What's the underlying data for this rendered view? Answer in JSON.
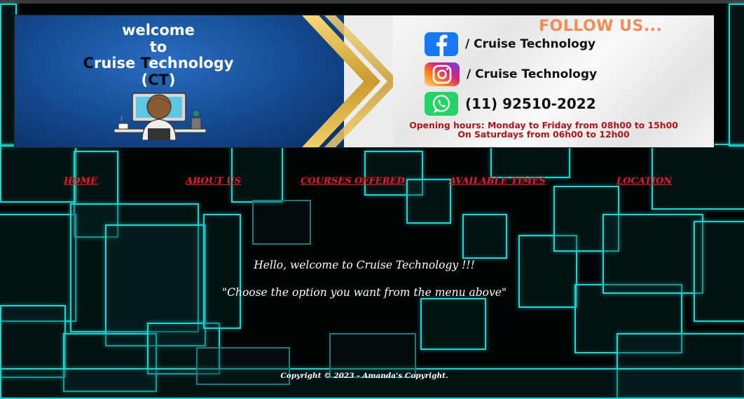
{
  "banner": {
    "welcome_line1": "welcome",
    "welcome_line2": "to",
    "welcome_c": "C",
    "welcome_ruise": "ruise ",
    "welcome_t": "T",
    "welcome_echnology": "echnology",
    "welcome_paren_open": "(",
    "welcome_ct": "CT",
    "welcome_paren_close": ")",
    "follow_us": "FOLLOW US...",
    "facebook": "/ Cruise Technology",
    "instagram": "/ Cruise Technology",
    "whatsapp": "(11) 92510-2022",
    "hours_line1": "Opening hours: Monday to Friday from 08h00 to 15h00",
    "hours_line2": "On Saturdays from 06h00 to 12h00",
    "colors": {
      "follow": "#f48c55",
      "hours": "#b0151a",
      "blue": "#175098"
    }
  },
  "nav": {
    "home": "HOME",
    "about": "ABOUT US",
    "courses": "COURSES OFFERED",
    "times": "AVAILABLE TIMES",
    "location": "LOCATION",
    "color": "#ee1b24"
  },
  "main": {
    "greeting": "Hello, welcome to Cruise Technology !!!",
    "instruction": "\"Choose the option you want from the menu above\""
  },
  "footer": {
    "copyright": "Copyright © 2023 - Amanda's Copyright."
  },
  "icons": [
    "facebook-icon",
    "instagram-icon",
    "whatsapp-icon",
    "computer-kid-icon"
  ]
}
